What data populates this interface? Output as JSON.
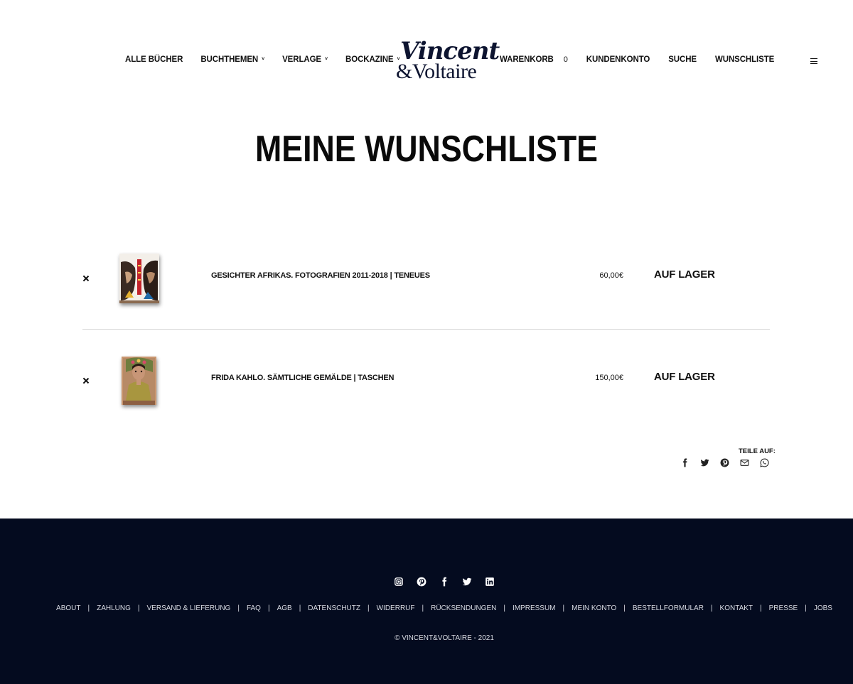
{
  "nav": {
    "left": [
      {
        "label": "ALLE BÜCHER",
        "dropdown": false
      },
      {
        "label": "BUCHTHEMEN",
        "dropdown": true
      },
      {
        "label": "VERLAGE",
        "dropdown": true
      },
      {
        "label": "BOCKAZINE",
        "dropdown": true
      }
    ],
    "right": {
      "cart_label": "WARENKORB",
      "cart_count": "0",
      "account": "KUNDENKONTO",
      "search": "SUCHE",
      "wishlist": "WUNSCHLISTE"
    },
    "chevron": "˅"
  },
  "logo": {
    "line1": "Vincent",
    "line2": "&Voltaire"
  },
  "page": {
    "title": "MEINE WUNSCHLISTE"
  },
  "wishlist": {
    "items": [
      {
        "name": "GESICHTER AFRIKAS. FOTOGRAFIEN 2011-2018 | TENEUES",
        "price": "60,00€",
        "stock": "AUF LAGER",
        "thumb_icon": "book-cover-africa"
      },
      {
        "name": "FRIDA KAHLO. SÄMTLICHE GEMÄLDE | TASCHEN",
        "price": "150,00€",
        "stock": "AUF LAGER",
        "thumb_icon": "book-cover-frida"
      }
    ]
  },
  "share": {
    "label": "TEILE AUF:",
    "icons": [
      "facebook-icon",
      "twitter-icon",
      "pinterest-icon",
      "mail-icon",
      "whatsapp-icon"
    ]
  },
  "footer": {
    "social_icons": [
      "instagram-icon",
      "pinterest-icon",
      "facebook-icon",
      "twitter-icon",
      "linkedin-icon"
    ],
    "links": [
      "ABOUT",
      "ZAHLUNG",
      "VERSAND & LIEFERUNG",
      "FAQ",
      "AGB",
      "DATENSCHUTZ",
      "WIDERRUF",
      "RÜCKSENDUNGEN",
      "IMPRESSUM",
      "MEIN KONTO",
      "BESTELLFORMULAR",
      "KONTAKT",
      "PRESSE",
      "JOBS"
    ],
    "separator": "|",
    "copyright": "© VINCENT&VOLTAIRE - 2021"
  },
  "colors": {
    "footer_bg": "#040b1f",
    "logo": "#0d1430",
    "text": "#111111"
  }
}
